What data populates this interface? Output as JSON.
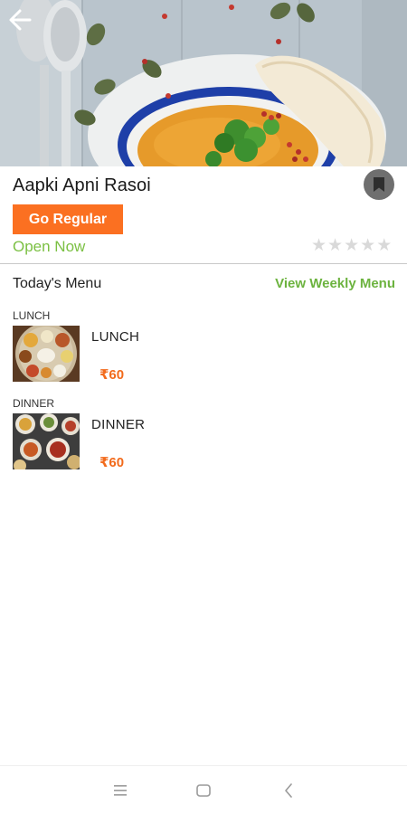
{
  "header": {
    "back_icon": "arrow-left-icon",
    "bookmark_icon": "bookmark-icon"
  },
  "kitchen": {
    "name": "Aapki Apni Rasoi",
    "cta_label": "Go Regular",
    "status": "Open Now",
    "rating": 0,
    "rating_max": 5
  },
  "menu": {
    "section_title": "Today's Menu",
    "weekly_link": "View Weekly Menu",
    "meals": [
      {
        "tag": "LUNCH",
        "name": "LUNCH",
        "price": "₹60"
      },
      {
        "tag": "DINNER",
        "name": "DINNER",
        "price": "₹60"
      }
    ]
  },
  "navbar": {
    "icons": [
      "menu-icon",
      "home-square-icon",
      "back-chevron-icon"
    ]
  },
  "colors": {
    "accent_orange": "#fb7021",
    "open_green": "#7bc043",
    "link_green": "#6cb33f",
    "price_orange": "#f26a1b",
    "bookmark_grey": "#6f6f6f"
  }
}
